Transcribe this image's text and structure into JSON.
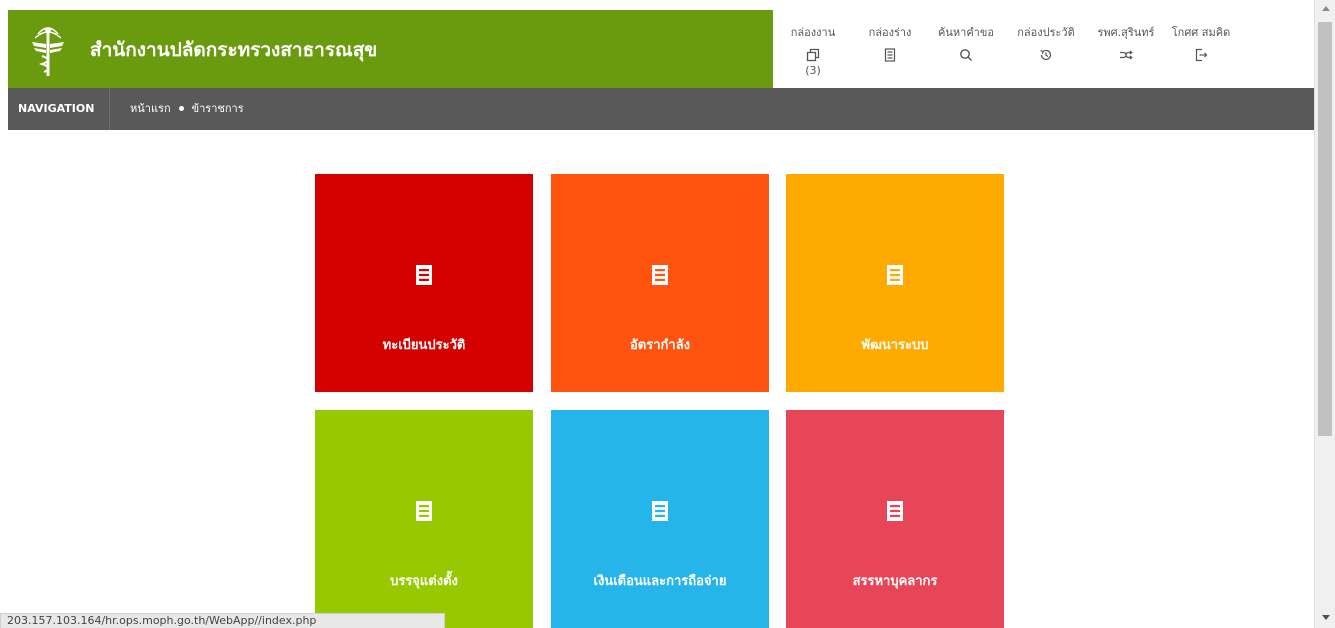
{
  "header": {
    "title": "สำนักงานปลัดกระทรวงสาธารณสุข",
    "brand_color": "#6a9a0d",
    "logo_icon": "ministry-emblem-icon"
  },
  "topnav": [
    {
      "label": "กล่องงาน",
      "icon": "window-restore-icon",
      "count": "(3)"
    },
    {
      "label": "กล่องร่าง",
      "icon": "draft-document-icon"
    },
    {
      "label": "ค้นหาคำขอ",
      "icon": "search-icon"
    },
    {
      "label": "กล่องประวัติ",
      "icon": "history-icon"
    },
    {
      "label": "รพศ.สุรินทร์",
      "icon": "shuffle-icon"
    },
    {
      "label": "โกศศ สมคิด",
      "icon": "sign-out-icon"
    }
  ],
  "navigation": {
    "label": "NAVIGATION",
    "breadcrumb": [
      "หน้าแรก",
      "ข้าราชการ"
    ]
  },
  "tiles": [
    {
      "label": "ทะเบียนประวัติ",
      "color": "#d50000",
      "icon": "list-document-icon"
    },
    {
      "label": "อัตรากำลัง",
      "color": "#ff5310",
      "icon": "list-document-icon"
    },
    {
      "label": "พัฒนาระบบ",
      "color": "#ffaa00",
      "icon": "list-document-icon"
    },
    {
      "label": "บรรจุแต่งตั้ง",
      "color": "#97c800",
      "icon": "list-document-icon"
    },
    {
      "label": "เงินเดือนและการถือจ่าย",
      "color": "#26b5ea",
      "icon": "list-document-icon"
    },
    {
      "label": "สรรหาบุคลากร",
      "color": "#e64658",
      "icon": "list-document-icon"
    }
  ],
  "status_url": "203.157.103.164/hr.ops.moph.go.th/WebApp//index.php"
}
